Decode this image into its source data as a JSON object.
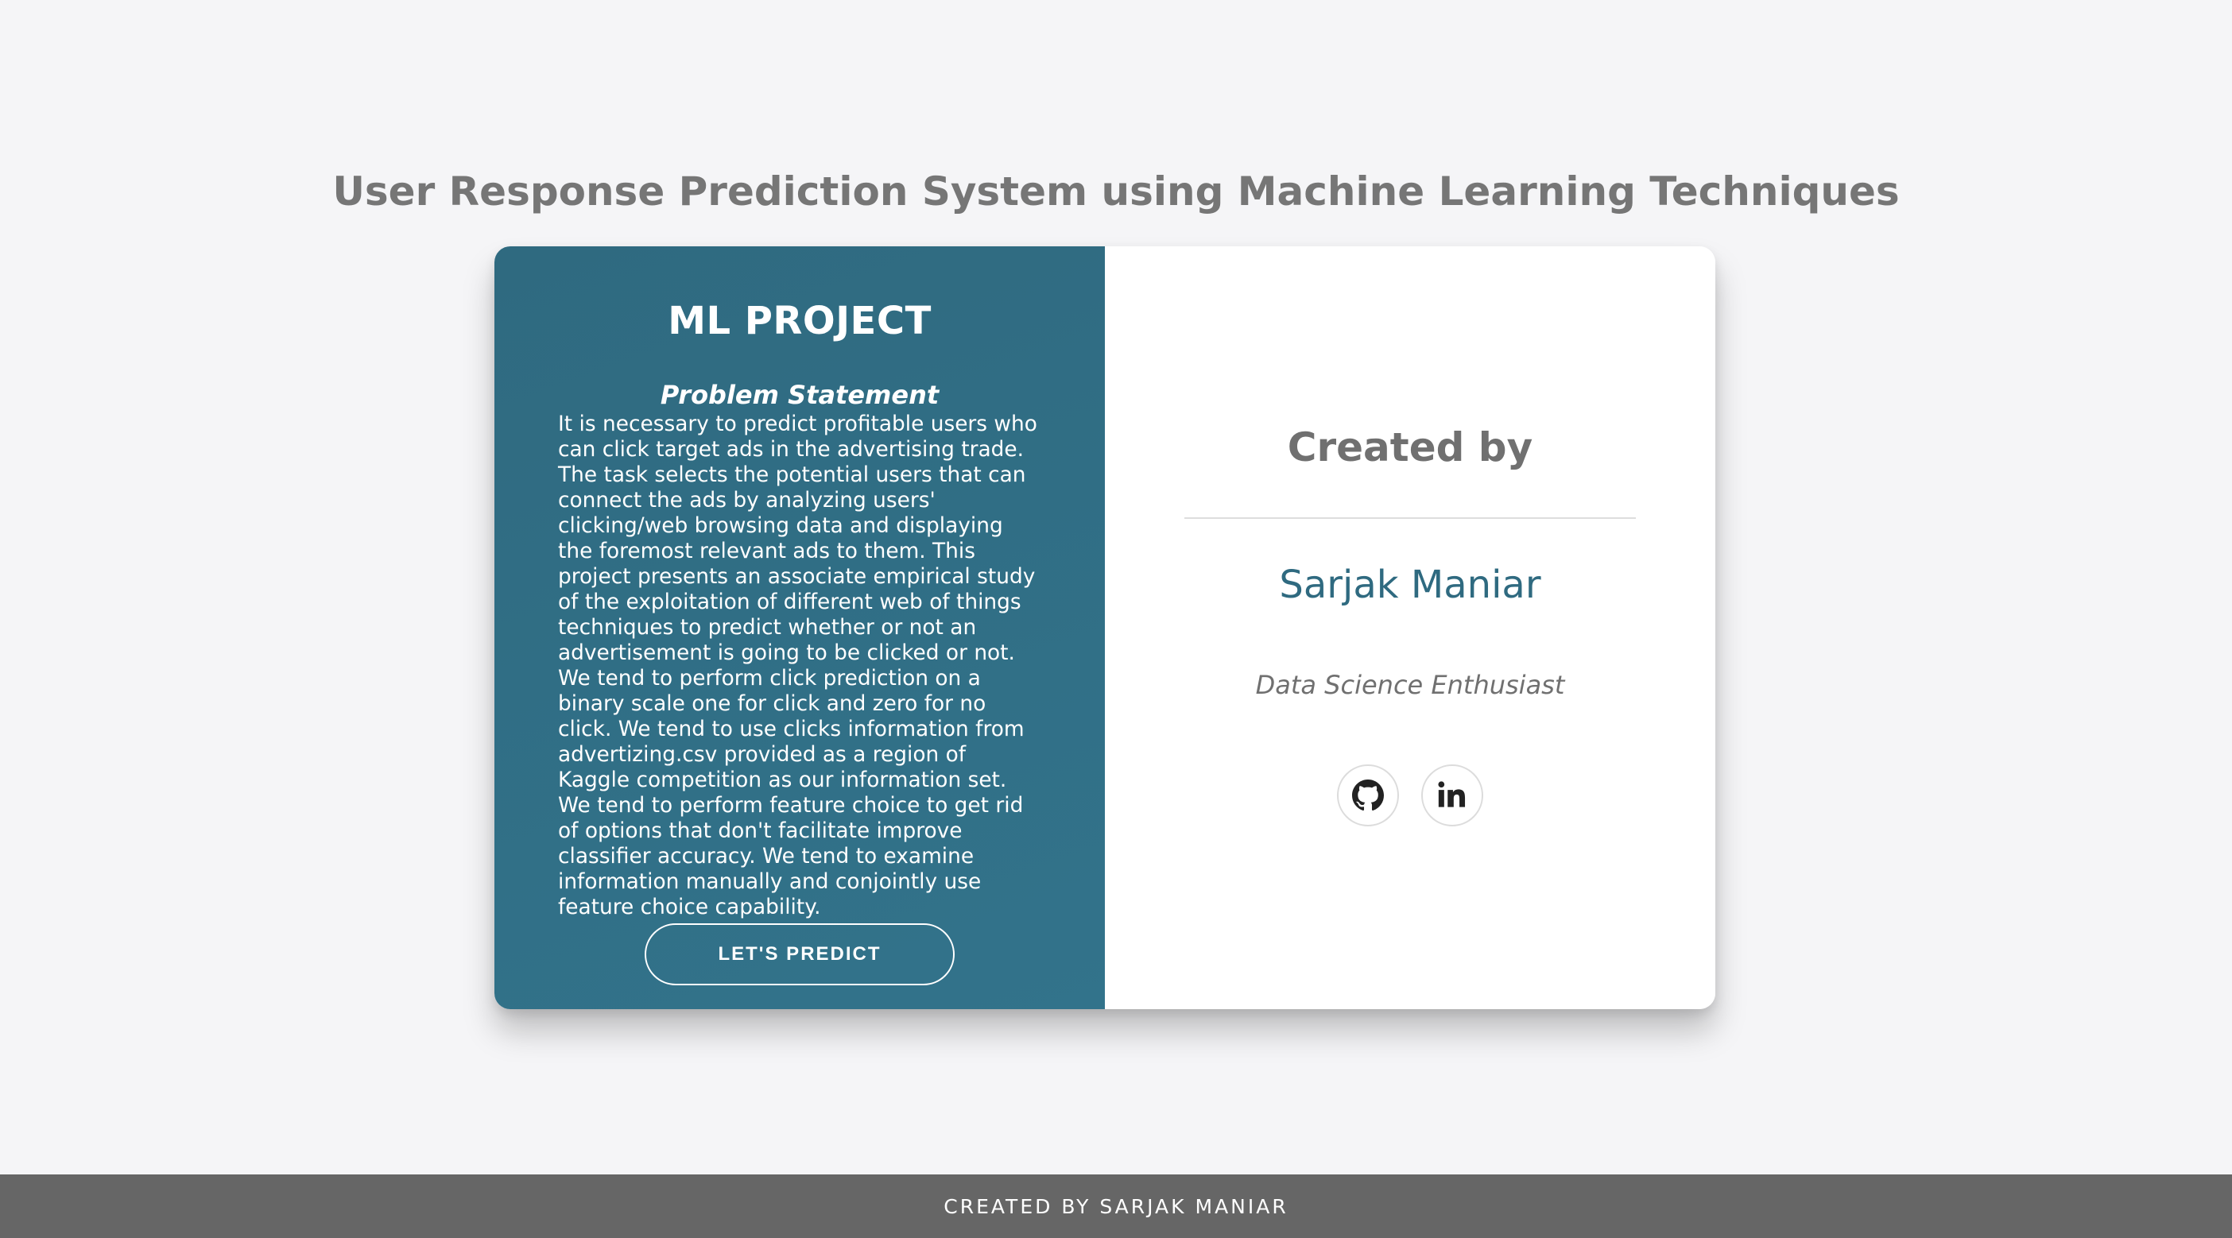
{
  "page": {
    "title": "User Response Prediction System using Machine Learning Techniques"
  },
  "card": {
    "left": {
      "project_title": "ML PROJECT",
      "problem_heading": "Problem Statement",
      "problem_text": "It is necessary to predict profitable users who can click target ads in the advertising trade. The task selects the potential users that can connect the ads by analyzing users' clicking/web browsing data and displaying the foremost relevant ads to them. This project presents an associate empirical study of the exploitation of different web of things techniques to predict whether or not an advertisement is going to be clicked or not. We tend to perform click prediction on a binary scale one for click and zero for no click. We tend to use clicks information from advertizing.csv provided as a region of Kaggle competition as our information set. We tend to perform feature choice to get rid of options that don't facilitate improve classifier accuracy. We tend to examine information manually and conjointly use feature choice capability.",
      "predict_button": "LET'S PREDICT"
    },
    "right": {
      "created_heading": "Created by",
      "author_name": "Sarjak Maniar",
      "author_role": "Data Science Enthusiast",
      "social": [
        {
          "icon": "github-icon"
        },
        {
          "icon": "linkedin-icon"
        }
      ]
    }
  },
  "footer": {
    "text": "CREATED BY SARJAK MANIAR"
  },
  "colors": {
    "background": "#f5f5f7",
    "panel_teal": "#32738b",
    "title_gray": "#767676",
    "name_teal": "#2f6a80",
    "footer_gray": "#666666"
  }
}
